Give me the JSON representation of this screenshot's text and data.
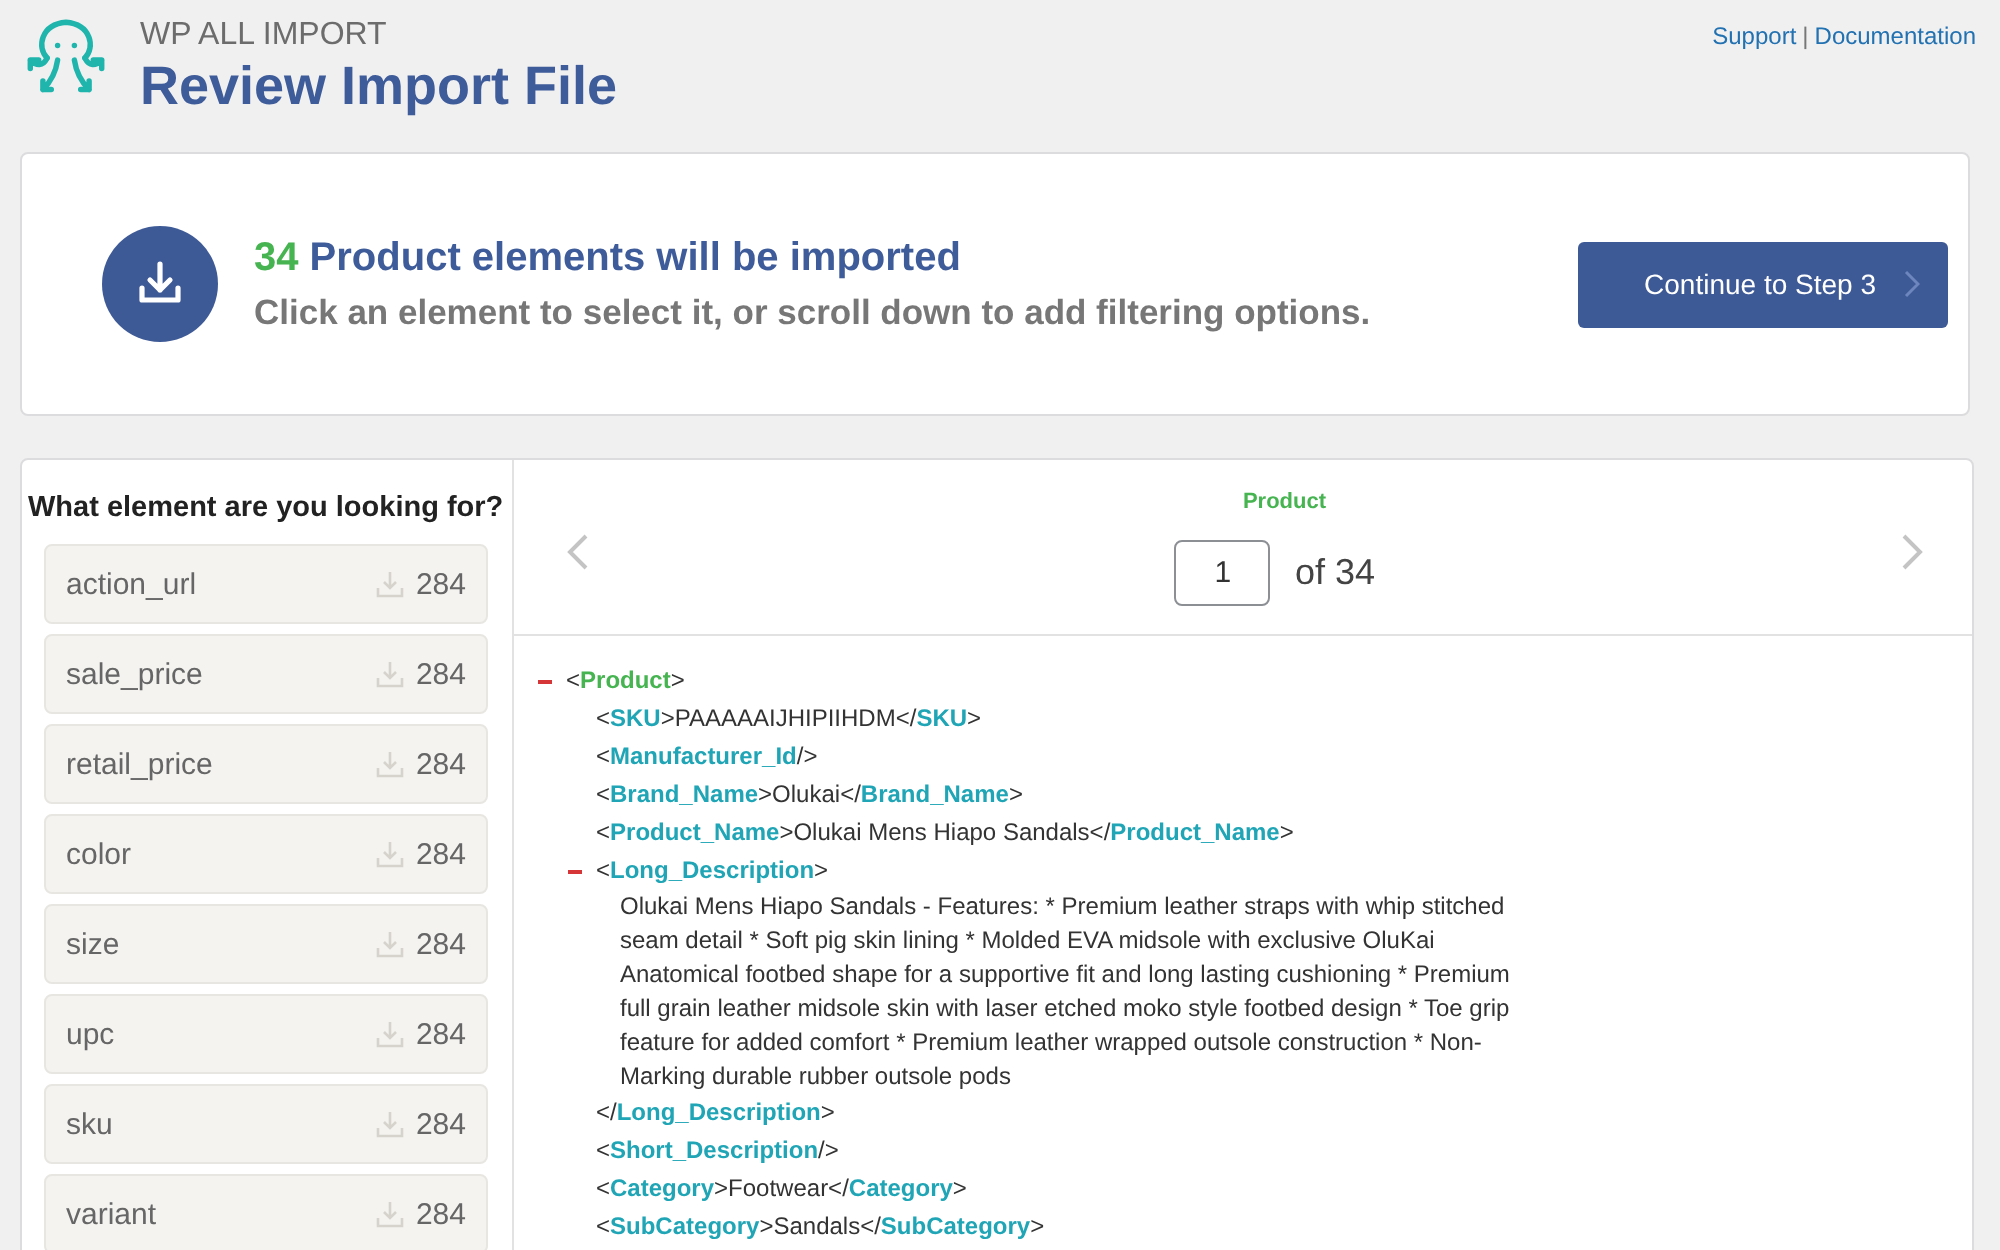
{
  "header": {
    "brand": "WP ALL IMPORT",
    "title": "Review Import File",
    "links": [
      "Support",
      "Documentation"
    ],
    "separator": "|"
  },
  "summary": {
    "count": "34",
    "headline": "Product elements will be imported",
    "subtitle": "Click an element to select it, or scroll down to add filtering options.",
    "button": "Continue to Step 3"
  },
  "elements": {
    "heading": "What element are you looking for?",
    "items": [
      {
        "name": "action_url",
        "count": "284"
      },
      {
        "name": "sale_price",
        "count": "284"
      },
      {
        "name": "retail_price",
        "count": "284"
      },
      {
        "name": "color",
        "count": "284"
      },
      {
        "name": "size",
        "count": "284"
      },
      {
        "name": "upc",
        "count": "284"
      },
      {
        "name": "sku",
        "count": "284"
      },
      {
        "name": "variant",
        "count": "284"
      }
    ]
  },
  "viewer": {
    "element": "Product",
    "page": "1",
    "of": "of 34",
    "syntax": {
      "open": "<",
      "close": ">",
      "end": "</",
      "self_end": "/>"
    },
    "tree": [
      {
        "kind": "parent",
        "tag": "Product",
        "expanded": true,
        "children": [
          {
            "kind": "leaf",
            "tag": "SKU",
            "text": "PAAAAAIJHIPIIHDM",
            "close_tag": "SKU"
          },
          {
            "kind": "empty",
            "tag": "Manufacturer_Id"
          },
          {
            "kind": "leaf",
            "tag": "Brand_Name",
            "text": "Olukai",
            "close_tag": "Brand_Name"
          },
          {
            "kind": "leaf",
            "tag": "Product_Name",
            "text": "Olukai Mens Hiapo Sandals",
            "close_tag": "Product_Name"
          },
          {
            "kind": "block",
            "tag": "Long_Description",
            "expanded": true,
            "close_tag": "Long_Description",
            "text": "Olukai Mens Hiapo Sandals - Features: * Premium leather straps with whip stitched seam detail * Soft pig skin lining * Molded EVA midsole with exclusive OluKai Anatomical footbed shape for a supportive fit and long lasting cushioning * Premium full grain leather midsole skin with laser etched moko style footbed design * Toe grip feature for added comfort * Premium leather wrapped outsole construction * Non-Marking durable rubber outsole pods"
          },
          {
            "kind": "empty",
            "tag": "Short_Description"
          },
          {
            "kind": "leaf",
            "tag": "Category",
            "text": "Footwear",
            "close_tag": "Category"
          },
          {
            "kind": "leaf",
            "tag": "SubCategory",
            "text": "Sandals",
            "close_tag": "SubCategory"
          }
        ]
      }
    ]
  }
}
